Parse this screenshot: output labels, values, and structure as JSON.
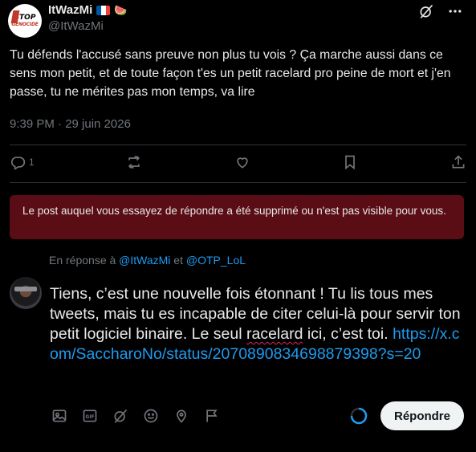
{
  "post": {
    "avatar_logo": {
      "line1": "STOP",
      "line2": "GENOCIDE"
    },
    "display_name": "ItWazMi",
    "badges": {
      "flag_colors": [
        "#0055a4",
        "#ffffff",
        "#ef4135"
      ],
      "emoji": "🍉"
    },
    "handle": "@ItWazMi",
    "text": "Tu défends l'accusé sans preuve non plus tu vois ? Ça marche aussi dans ce sens mon petit, et de toute façon t'es un petit racelard pro peine de mort et j'en passe, tu ne mérites pas mon temps, va lire",
    "timestamp": "9:39 PM · 29 juin 2026",
    "reply_count": "1",
    "top_icons": [
      "grok-icon",
      "more-icon"
    ]
  },
  "deleted_notice": "Le post auquel vous essayez de répondre a été supprimé ou n'est pas visible pour vous.",
  "reply_to": {
    "prefix": "En réponse à ",
    "user1": "@ItWazMi",
    "joiner": " et ",
    "user2": "@OTP_LoL"
  },
  "compose": {
    "text_part1": "Tiens, c’est une nouvelle fois étonnant ! Tu lis tous mes tweets, mais tu es incapable de citer celui-là pour servir ton petit logiciel binaire. Le seul ",
    "misspelled": "racelard",
    "text_part2": " ici, c’est toi.",
    "link": "https://x.com/SaccharoNo/status/2070890834698879398?s=20"
  },
  "toolbar_icons": [
    "image-icon",
    "gif-icon",
    "grok-icon",
    "emoji-icon",
    "location-icon",
    "flag-icon"
  ],
  "reply_button": "Répondre",
  "colors": {
    "accent": "#1d9bf0",
    "banner_bg": "#5a0d14",
    "muted": "#71767b"
  }
}
